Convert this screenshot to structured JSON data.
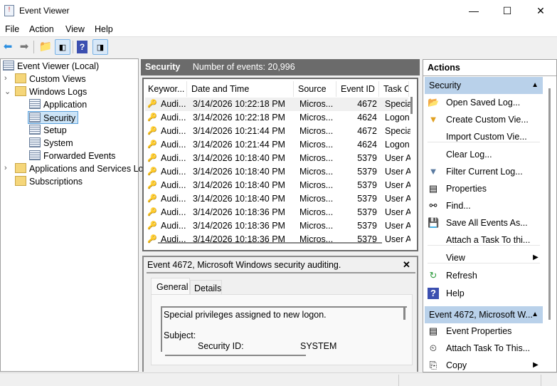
{
  "window": {
    "title": "Event Viewer",
    "minimize": "—",
    "maximize": "☐",
    "close": "✕"
  },
  "menu": [
    "File",
    "Action",
    "View",
    "Help"
  ],
  "tree": {
    "root": "Event Viewer (Local)",
    "custom_views": "Custom Views",
    "windows_logs": "Windows Logs",
    "application": "Application",
    "security": "Security",
    "setup": "Setup",
    "system": "System",
    "forwarded": "Forwarded Events",
    "apps_services": "Applications and Services Lo",
    "subscriptions": "Subscriptions"
  },
  "middle": {
    "title": "Security",
    "count": "Number of events: 20,996"
  },
  "columns": [
    "Keywor...",
    "Date and Time",
    "Source",
    "Event ID",
    "Task C"
  ],
  "rows": [
    [
      "Audi...",
      "3/14/2026 10:22:18 PM",
      "Micros...",
      "4672",
      "Specia"
    ],
    [
      "Audi...",
      "3/14/2026 10:22:18 PM",
      "Micros...",
      "4624",
      "Logon"
    ],
    [
      "Audi...",
      "3/14/2026 10:21:44 PM",
      "Micros...",
      "4672",
      "Specia"
    ],
    [
      "Audi...",
      "3/14/2026 10:21:44 PM",
      "Micros...",
      "4624",
      "Logon"
    ],
    [
      "Audi...",
      "3/14/2026 10:18:40 PM",
      "Micros...",
      "5379",
      "User A"
    ],
    [
      "Audi...",
      "3/14/2026 10:18:40 PM",
      "Micros...",
      "5379",
      "User A"
    ],
    [
      "Audi...",
      "3/14/2026 10:18:40 PM",
      "Micros...",
      "5379",
      "User A"
    ],
    [
      "Audi...",
      "3/14/2026 10:18:40 PM",
      "Micros...",
      "5379",
      "User A"
    ],
    [
      "Audi...",
      "3/14/2026 10:18:36 PM",
      "Micros...",
      "5379",
      "User A"
    ],
    [
      "Audi...",
      "3/14/2026 10:18:36 PM",
      "Micros...",
      "5379",
      "User A"
    ],
    [
      "Audi...",
      "3/14/2026 10:18:36 PM",
      "Micros...",
      "5379",
      "User A"
    ]
  ],
  "detail": {
    "title": "Event 4672, Microsoft Windows security auditing.",
    "close": "✕",
    "tab_general": "General",
    "tab_details": "Details",
    "line1": "Special privileges assigned to new logon.",
    "subject": "Subject:",
    "sid_label": "Security ID:",
    "sid_value": "SYSTEM"
  },
  "actions": {
    "header": "Actions",
    "sec1": "Security",
    "sec2": "Event 4672, Microsoft W...",
    "items1": [
      "Open Saved Log...",
      "Create Custom Vie...",
      "Import Custom Vie...",
      "Clear Log...",
      "Filter Current Log...",
      "Properties",
      "Find...",
      "Save All Events As...",
      "Attach a Task To thi...",
      "View",
      "Refresh",
      "Help"
    ],
    "items2": [
      "Event Properties",
      "Attach Task To This...",
      "Copy"
    ]
  }
}
